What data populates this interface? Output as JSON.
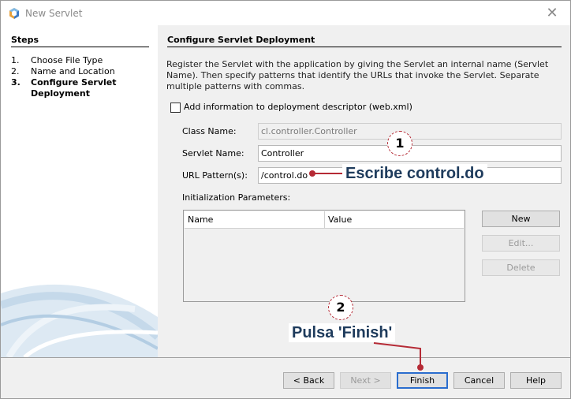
{
  "window": {
    "title": "New Servlet",
    "close_glyph": "✕"
  },
  "steps": {
    "title": "Steps",
    "items": [
      {
        "num": "1.",
        "label": "Choose File Type"
      },
      {
        "num": "2.",
        "label": "Name and Location"
      },
      {
        "num": "3.",
        "label": "Configure Servlet Deployment"
      }
    ]
  },
  "main": {
    "title": "Configure Servlet Deployment",
    "description": "Register the Servlet with the application by giving the Servlet an internal name (Servlet Name). Then specify patterns that identify the URLs that invoke the Servlet. Separate multiple patterns with commas.",
    "checkbox_label": "Add information to deployment descriptor (web.xml)",
    "class_name_label": "Class Name:",
    "class_name_value": "cl.controller.Controller",
    "servlet_name_label": "Servlet Name:",
    "servlet_name_value": "Controller",
    "url_pattern_label": "URL Pattern(s):",
    "url_pattern_value": "/control.do",
    "init_params_label": "Initialization Parameters:",
    "table_headers": [
      "Name",
      "Value"
    ],
    "buttons": {
      "new": "New",
      "edit": "Edit...",
      "delete": "Delete"
    }
  },
  "footer": {
    "back": "< Back",
    "next": "Next >",
    "finish": "Finish",
    "cancel": "Cancel",
    "help": "Help"
  },
  "annotations": {
    "badge1": "1",
    "badge2": "2",
    "callout1": "Escribe control.do",
    "callout2": "Pulsa 'Finish'",
    "accent_color": "#b52a35"
  }
}
